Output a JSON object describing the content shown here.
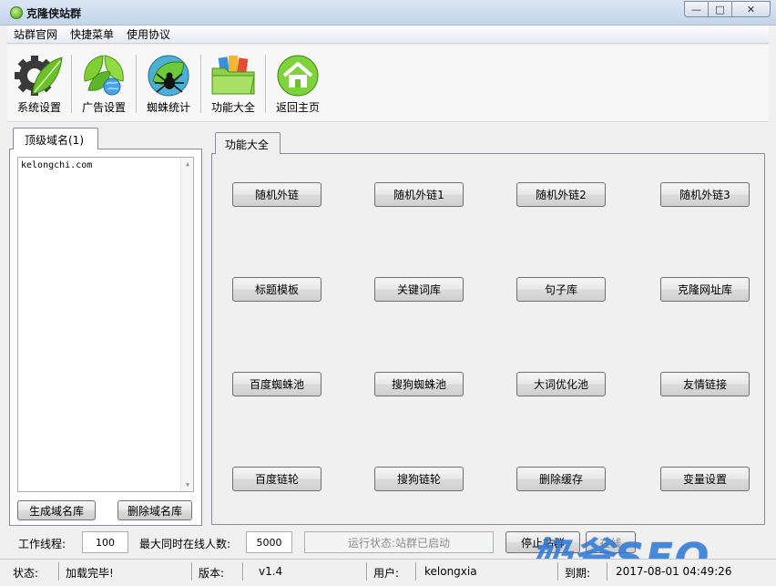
{
  "window": {
    "title": "克隆侠站群",
    "minimize": "—",
    "maximize": "□",
    "close": "✕"
  },
  "menu": [
    "站群官网",
    "快捷菜单",
    "使用协议"
  ],
  "toolbar": [
    {
      "label": "系统设置",
      "icon": "gear-leaf-icon"
    },
    {
      "label": "广告设置",
      "icon": "leaf-globe-icon"
    },
    {
      "label": "蜘蛛统计",
      "icon": "spider-icon"
    },
    {
      "label": "功能大全",
      "icon": "folder-icon"
    },
    {
      "label": "返回主页",
      "icon": "home-icon"
    }
  ],
  "left": {
    "tab": "顶级域名(1)",
    "domains": "kelongchi.com",
    "generate_btn": "生成域名库",
    "delete_btn": "删除域名库"
  },
  "right": {
    "tab": "功能大全",
    "buttons": [
      "随机外链",
      "随机外链1",
      "随机外链2",
      "随机外链3",
      "标题模板",
      "关键词库",
      "句子库",
      "克隆网址库",
      "百度蜘蛛池",
      "搜狗蜘蛛池",
      "大词优化池",
      "友情链接",
      "百度链轮",
      "搜狗链轮",
      "删除缓存",
      "变量设置"
    ]
  },
  "bottom": {
    "threads_label": "工作线程:",
    "threads_value": "100",
    "max_online_label": "最大同时在线人数:",
    "max_online_value": "5000",
    "run_status": "运行状态:站群已启动",
    "stop_btn": "停止站群",
    "extra_btn": "在线",
    "watermark": "奶爸SEO"
  },
  "statusbar": {
    "status_label": "状态:",
    "status_value": "加载完毕!",
    "version_label": "版本:",
    "version_value": "v1.4",
    "user_label": "用户:",
    "user_value": "kelongxia",
    "expire_label": "到期:",
    "expire_value": "2017-08-01 04:49:26"
  }
}
